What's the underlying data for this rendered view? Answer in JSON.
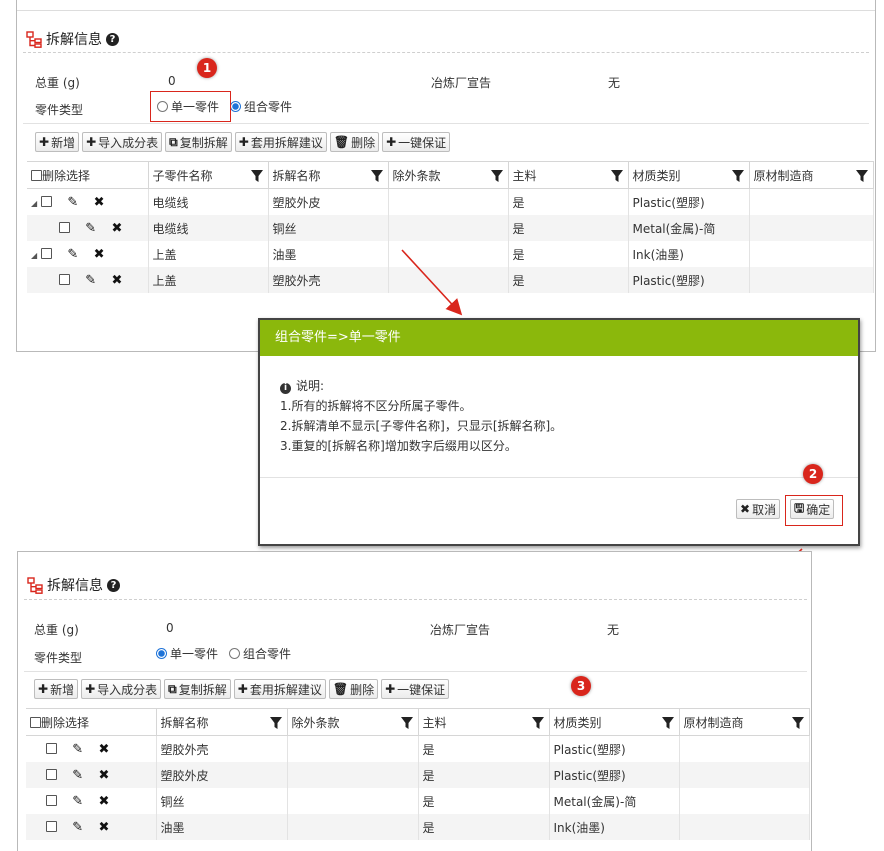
{
  "top_panel": {
    "section_title": "拆解信息",
    "weight_label": "总重 (g)",
    "weight_value": "0",
    "smelter_label": "冶炼厂宣告",
    "smelter_value": "无",
    "part_type_label": "零件类型",
    "radio_single": "单一零件",
    "radio_combined": "组合零件",
    "selected_part_type": "组合零件",
    "toolbar": [
      "新增",
      "导入成分表",
      "复制拆解",
      "套用拆解建议",
      "删除",
      "一键保证"
    ],
    "columns": [
      "删除选择",
      "子零件名称",
      "拆解名称",
      "除外条款",
      "主料",
      "材质类别",
      "原材制造商"
    ],
    "rows": [
      {
        "level": 1,
        "sub_part": "电缆线",
        "name": "塑胶外皮",
        "exclusion": "",
        "main": "是",
        "material": "Plastic(塑膠)",
        "maker": ""
      },
      {
        "level": 2,
        "sub_part": "电缆线",
        "name": "铜丝",
        "exclusion": "",
        "main": "是",
        "material": "Metal(金属)-简",
        "maker": ""
      },
      {
        "level": 1,
        "sub_part": "上盖",
        "name": "油墨",
        "exclusion": "",
        "main": "是",
        "material": "Ink(油墨)",
        "maker": ""
      },
      {
        "level": 2,
        "sub_part": "上盖",
        "name": "塑胶外壳",
        "exclusion": "",
        "main": "是",
        "material": "Plastic(塑膠)",
        "maker": ""
      }
    ]
  },
  "dialog": {
    "title": "组合零件=>单一零件",
    "note_heading": "说明:",
    "lines": [
      "1.所有的拆解将不区分所属子零件。",
      "2.拆解清单不显示[子零件名称]，只显示[拆解名称]。",
      "3.重复的[拆解名称]增加数字后缀用以区分。"
    ],
    "cancel_label": "取消",
    "confirm_label": "确定"
  },
  "bottom_panel": {
    "section_title": "拆解信息",
    "weight_label": "总重 (g)",
    "weight_value": "0",
    "smelter_label": "冶炼厂宣告",
    "smelter_value": "无",
    "part_type_label": "零件类型",
    "radio_single": "单一零件",
    "radio_combined": "组合零件",
    "selected_part_type": "单一零件",
    "toolbar": [
      "新增",
      "导入成分表",
      "复制拆解",
      "套用拆解建议",
      "删除",
      "一键保证"
    ],
    "columns": [
      "删除选择",
      "拆解名称",
      "除外条款",
      "主料",
      "材质类别",
      "原材制造商"
    ],
    "rows": [
      {
        "name": "塑胶外壳",
        "exclusion": "",
        "main": "是",
        "material": "Plastic(塑膠)",
        "maker": ""
      },
      {
        "name": "塑胶外皮",
        "exclusion": "",
        "main": "是",
        "material": "Plastic(塑膠)",
        "maker": ""
      },
      {
        "name": "铜丝",
        "exclusion": "",
        "main": "是",
        "material": "Metal(金属)-简",
        "maker": ""
      },
      {
        "name": "油墨",
        "exclusion": "",
        "main": "是",
        "material": "Ink(油墨)",
        "maker": ""
      }
    ]
  },
  "annotations": {
    "badge1": "1",
    "badge2": "2",
    "badge3": "3",
    "color": "#d9261c"
  },
  "icons": {
    "section": "sitemap-icon",
    "help": "question-circle-icon",
    "add": "plus-icon",
    "copy": "copy-icon",
    "delete": "trash-icon",
    "edit": "pencil-icon",
    "remove": "x-icon",
    "filter": "funnel-icon",
    "info": "info-circle-icon",
    "cancel": "x-icon",
    "save": "floppy-icon"
  },
  "colors": {
    "dialog_header": "#8bb80c",
    "radio_selected": "#1e73d8",
    "annotation": "#d9261c"
  }
}
